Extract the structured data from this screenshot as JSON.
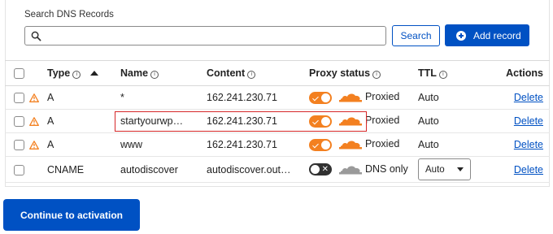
{
  "search": {
    "label": "Search DNS Records",
    "placeholder": "",
    "value": "",
    "search_button": "Search",
    "add_button": "Add record"
  },
  "table": {
    "headers": {
      "type": "Type",
      "name": "Name",
      "content": "Content",
      "proxy": "Proxy status",
      "ttl": "TTL",
      "actions": "Actions"
    },
    "rows": [
      {
        "type": "A",
        "name": "*",
        "content": "162.241.230.71",
        "proxy": "Proxied",
        "proxied": true,
        "ttl": "Auto",
        "action": "Delete",
        "warning": true
      },
      {
        "type": "A",
        "name": "startyourwp…",
        "content": "162.241.230.71",
        "proxy": "Proxied",
        "proxied": true,
        "ttl": "Auto",
        "action": "Delete",
        "warning": true
      },
      {
        "type": "A",
        "name": "www",
        "content": "162.241.230.71",
        "proxy": "Proxied",
        "proxied": true,
        "ttl": "Auto",
        "action": "Delete",
        "warning": true
      },
      {
        "type": "CNAME",
        "name": "autodiscover",
        "content": "autodiscover.out…",
        "proxy": "DNS only",
        "proxied": false,
        "ttl": "Auto",
        "action": "Delete",
        "warning": false
      }
    ]
  },
  "continue_button": "Continue to activation",
  "colors": {
    "accent": "#0051c3",
    "proxy_orange": "#f38020",
    "warning": "#f38020",
    "highlight": "#d62728"
  }
}
